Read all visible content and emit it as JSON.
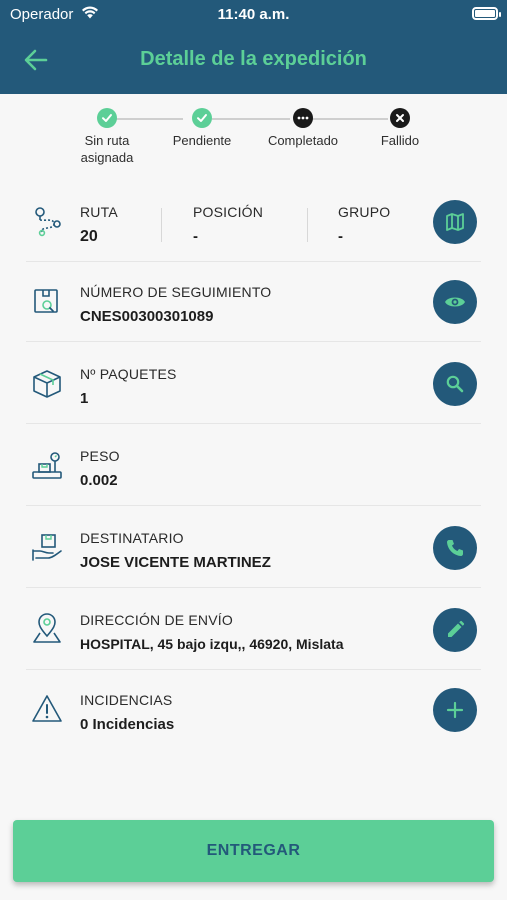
{
  "status_bar": {
    "carrier": "Operador",
    "time": "11:40 a.m."
  },
  "header": {
    "title": "Detalle de la expedición"
  },
  "stepper": {
    "steps": [
      {
        "label_line1": "Sin ruta",
        "label_line2": "asignada",
        "state": "done"
      },
      {
        "label_line1": "Pendiente",
        "label_line2": "",
        "state": "done"
      },
      {
        "label_line1": "Completado",
        "label_line2": "",
        "state": "current"
      },
      {
        "label_line1": "Fallido",
        "label_line2": "",
        "state": "failed"
      }
    ]
  },
  "rows": {
    "ruta": {
      "label": "RUTA",
      "value": "20"
    },
    "posicion": {
      "label": "POSICIÓN",
      "value": "-"
    },
    "grupo": {
      "label": "GRUPO",
      "value": "-"
    },
    "seguimiento": {
      "label": "NÚMERO DE SEGUIMIENTO",
      "value": "CNES00300301089"
    },
    "paquetes": {
      "label": "Nº PAQUETES",
      "value": "1"
    },
    "peso": {
      "label": "PESO",
      "value": "0.002"
    },
    "destinatario": {
      "label": "DESTINATARIO",
      "value": "JOSE VICENTE MARTINEZ"
    },
    "direccion": {
      "label": "DIRECCIÓN DE ENVÍO",
      "value": "HOSPITAL, 45 bajo izqu,, 46920, Mislata"
    },
    "incidencias": {
      "label": "INCIDENCIAS",
      "value": "0 Incidencias"
    }
  },
  "deliver_button": {
    "label": "ENTREGAR"
  },
  "colors": {
    "header": "#23597a",
    "accent": "#5ccf97",
    "action": "#23597a"
  }
}
